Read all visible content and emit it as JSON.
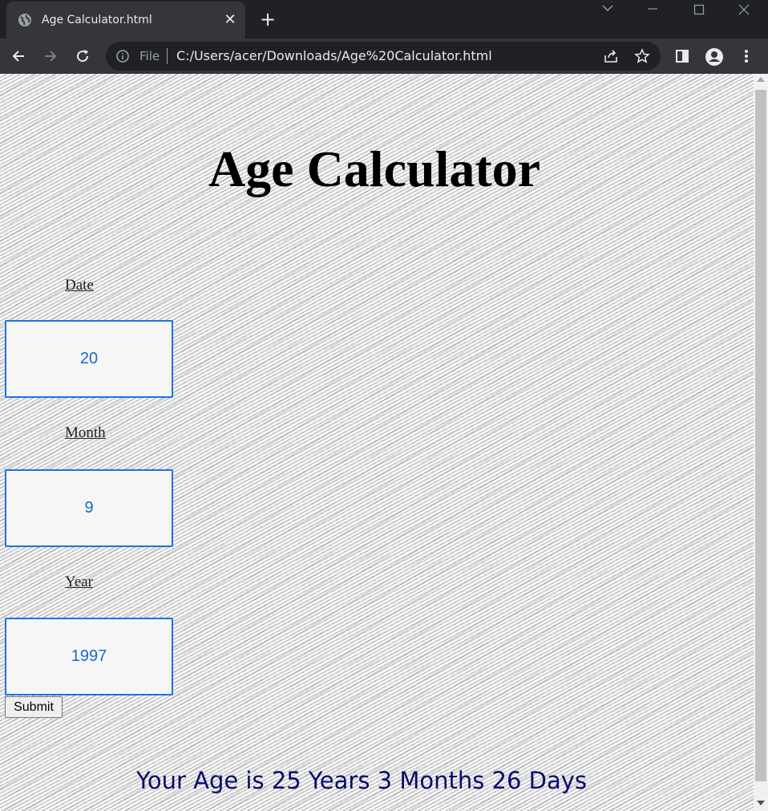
{
  "browser": {
    "tab_title": "Age Calculator.html",
    "omnibox_scheme": "File",
    "url": "C:/Users/acer/Downloads/Age%20Calculator.html",
    "icons": [
      "globe-icon",
      "close-icon",
      "plus-icon",
      "back-arrow-icon",
      "forward-arrow-icon",
      "reload-icon",
      "info-icon",
      "share-icon",
      "star-icon",
      "side-panel-icon",
      "profile-icon",
      "more-vert-icon"
    ]
  },
  "page": {
    "title": "Age Calculator",
    "date_label": "Date",
    "date_value": "20",
    "month_label": "Month",
    "month_value": "9",
    "year_label": "Year",
    "year_value": "1997",
    "submit_label": "Submit",
    "result_text": "Your Age is 25 Years 3 Months 26 Days"
  },
  "colors": {
    "input_border": "#1a73e8",
    "input_text": "#1967d2",
    "result_text": "#0b0b6e"
  }
}
